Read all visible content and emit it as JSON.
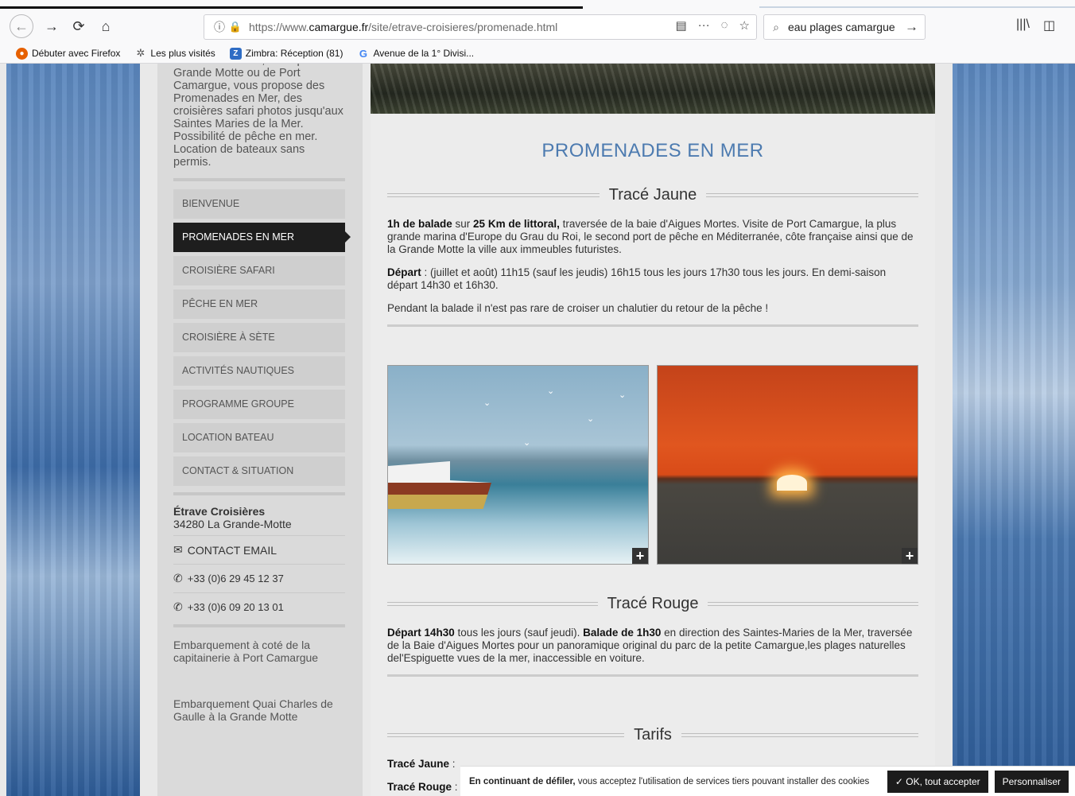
{
  "browser": {
    "url_prefix": "https://www.",
    "url_domain": "camargue.fr",
    "url_path": "/site/etrave-croisieres/promenade.html",
    "search_value": "eau plages camargue",
    "bookmarks": [
      {
        "label": "Débuter avec Firefox",
        "icon": "firefox-icon",
        "color": "#e66000"
      },
      {
        "label": "Les plus visités",
        "icon": "gear-icon",
        "color": "#555555"
      },
      {
        "label": "Zimbra: Réception (81)",
        "icon": "zimbra-icon",
        "color": "#2e6cc4"
      },
      {
        "label": "Avenue de la 1° Divisi...",
        "icon": "google-icon",
        "color": "#4285f4"
      }
    ]
  },
  "sidebar": {
    "intro": "Etrave Croisières, au départ de la Grande Motte ou de Port Camargue, vous propose des Promenades en Mer, des croisières safari photos jusqu'aux Saintes Maries de la Mer. Possibilité de pêche en mer. Location de bateaux sans permis.",
    "menu": [
      {
        "label": "Bienvenue",
        "active": false
      },
      {
        "label": "Promenades en mer",
        "active": true
      },
      {
        "label": "Croisière safari",
        "active": false
      },
      {
        "label": "Pêche en mer",
        "active": false
      },
      {
        "label": "Croisière à Sète",
        "active": false
      },
      {
        "label": "Activités nautiques",
        "active": false
      },
      {
        "label": "Programme groupe",
        "active": false
      },
      {
        "label": "Location bateau",
        "active": false
      },
      {
        "label": "Contact & situation",
        "active": false
      }
    ],
    "company_name": "Étrave Croisières",
    "company_city": "34280 La Grande-Motte",
    "email_label": "CONTACT EMAIL",
    "phone1": "+33 (0)6 29 45 12 37",
    "phone2": "+33 (0)6 09 20 13 01",
    "embark1": "Embarquement à coté de la capitainerie à Port Camargue",
    "embark2": "Embarquement Quai Charles de Gaulle à la Grande Motte"
  },
  "main": {
    "title": "PROMENADES EN MER",
    "jaune": {
      "heading": "Tracé Jaune",
      "p1_b1": "1h de balade",
      "p1_t1": " sur ",
      "p1_b2": "25 Km de littoral,",
      "p1_t2": " traversée de la baie d'Aigues Mortes. Visite de Port Camargue, la plus grande marina d'Europe du Grau du Roi, le second port de pêche en Méditerranée, côte française ainsi que de la Grande Motte la ville aux immeubles futuristes.",
      "p2_b": "Départ",
      "p2_t": " :  (juillet et août) 11h15 (sauf les jeudis) 16h15 tous les jours 17h30 tous les jours. En demi-saison départ 14h30 et 16h30.",
      "p3": "Pendant la balade il n'est pas rare de croiser un chalutier du retour de la pêche !"
    },
    "rouge": {
      "heading": "Tracé Rouge",
      "b1": "Départ 14h30",
      "t1": " tous les jours (sauf jeudi). ",
      "b2": "Balade de 1h30",
      "t2": " en direction des Saintes-Maries de la Mer, traversée de la Baie d'Aigues Mortes pour un panoramique original du parc de la petite Camargue,les plages naturelles del'Espiguette vues de la mer, inaccessible en voiture."
    },
    "tarifs": {
      "heading": "Tarifs",
      "row1": "Tracé Jaune",
      "row2": "Tracé Rouge"
    }
  },
  "cookie": {
    "bold": "En continuant de défiler,",
    "text": " vous acceptez l'utilisation de services tiers pouvant installer des cookies",
    "accept": "✓ OK, tout accepter",
    "customize": "Personnaliser"
  }
}
